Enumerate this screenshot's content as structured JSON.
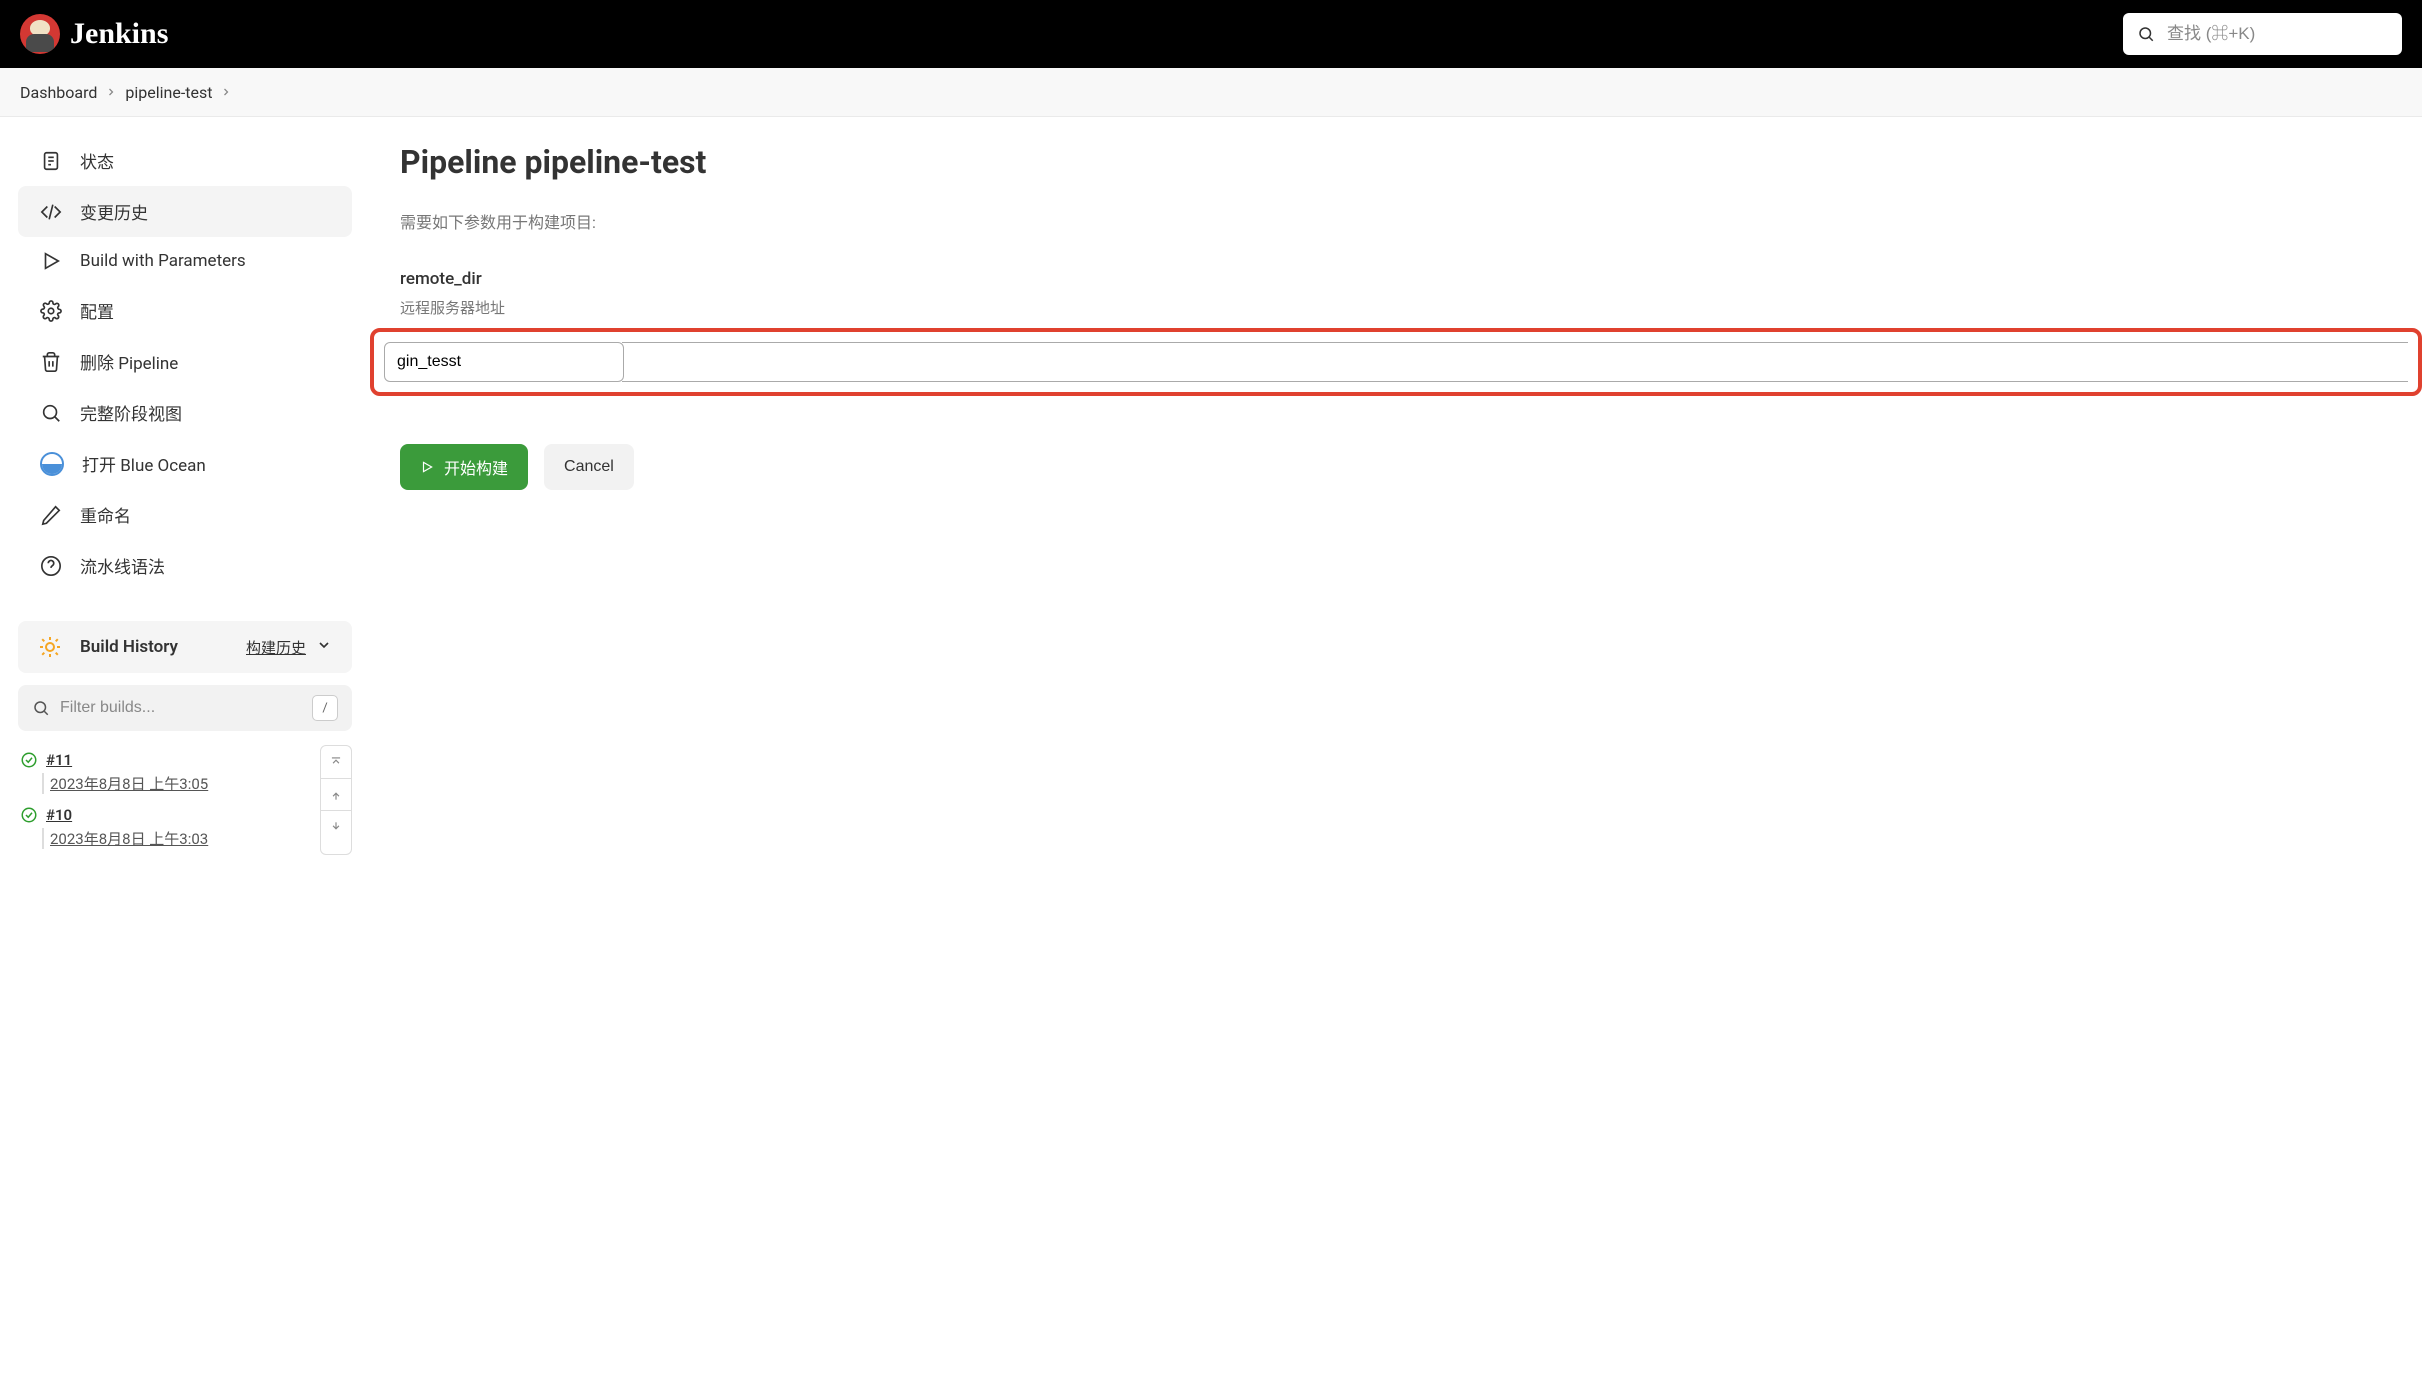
{
  "header": {
    "brand": "Jenkins",
    "search_placeholder": "查找 (⌘+K)"
  },
  "breadcrumbs": [
    {
      "label": "Dashboard"
    },
    {
      "label": "pipeline-test"
    }
  ],
  "sidebar": {
    "items": [
      {
        "key": "status",
        "label": "状态",
        "icon": "document-icon"
      },
      {
        "key": "changes",
        "label": "变更历史",
        "icon": "code-icon",
        "active": true
      },
      {
        "key": "build-params",
        "label": "Build with Parameters",
        "icon": "play-icon"
      },
      {
        "key": "configure",
        "label": "配置",
        "icon": "gear-icon"
      },
      {
        "key": "delete",
        "label": "删除 Pipeline",
        "icon": "trash-icon"
      },
      {
        "key": "stage-view",
        "label": "完整阶段视图",
        "icon": "search-icon"
      },
      {
        "key": "blue-ocean",
        "label": "打开 Blue Ocean",
        "icon": "blue-ocean-icon"
      },
      {
        "key": "rename",
        "label": "重命名",
        "icon": "pencil-icon"
      },
      {
        "key": "syntax",
        "label": "流水线语法",
        "icon": "help-icon"
      }
    ]
  },
  "build_history": {
    "title": "Build History",
    "trend_label": "构建历史",
    "filter_placeholder": "Filter builds...",
    "filter_key_hint": "/",
    "builds": [
      {
        "number": "#11",
        "time": "2023年8月8日 上午3:05",
        "status": "success"
      },
      {
        "number": "#10",
        "time": "2023年8月8日 上午3:03",
        "status": "success"
      }
    ]
  },
  "main": {
    "title": "Pipeline pipeline-test",
    "description": "需要如下参数用于构建项目:",
    "param": {
      "name": "remote_dir",
      "desc": "远程服务器地址",
      "value": "gin_tesst"
    },
    "actions": {
      "build": "开始构建",
      "cancel": "Cancel"
    }
  }
}
